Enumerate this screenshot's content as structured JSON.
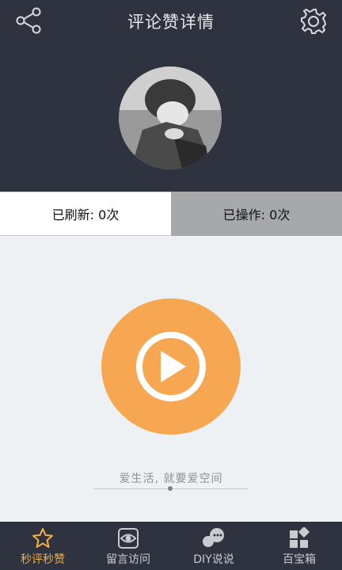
{
  "header": {
    "title": "评论赞详情"
  },
  "stats": {
    "refreshed": "已刷新:  0次",
    "operated": "已操作:  0次"
  },
  "slogan": "爱生活, 就要爱空间",
  "tabs": [
    {
      "label": "秒评秒赞",
      "icon": "star-icon",
      "active": true
    },
    {
      "label": "留言访问",
      "icon": "eye-icon"
    },
    {
      "label": "DIY说说",
      "icon": "chat-bubble-icon"
    },
    {
      "label": "百宝箱",
      "icon": "grid-icon"
    }
  ],
  "colors": {
    "header_bg": "#2f323f",
    "accent": "#f7a751",
    "active_tab": "#f3b03f"
  }
}
